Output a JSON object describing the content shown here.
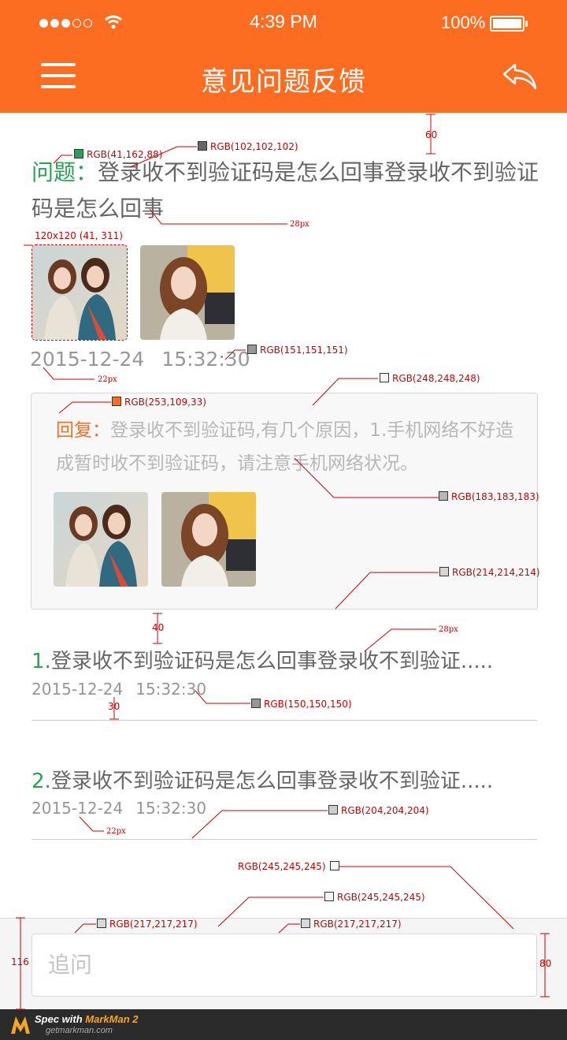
{
  "status": {
    "time": "4:39 PM",
    "battery": "100%"
  },
  "header": {
    "title": "意见问题反馈",
    "menu_icon": "menu-icon",
    "back_icon": "back-arrow-icon",
    "bg_color": "#fd6d21"
  },
  "question": {
    "label": "问题：",
    "text": "登录收不到验证码是怎么回事登录收不到验证码是怎么回事",
    "date": "2015-12-24",
    "time": "15:32:30"
  },
  "reply": {
    "label": "回复：",
    "text": "登录收不到验证码,有几个原因，1.手机网络不好造成暂时收不到验证码，请注意手机网络状况。"
  },
  "items": [
    {
      "index": "1.",
      "title": "登录收不到验证码是怎么回事登录收不到验证.....",
      "date": "2015-12-24",
      "time": "15:32:30"
    },
    {
      "index": "2.",
      "title": "登录收不到验证码是怎么回事登录收不到验证.....",
      "date": "2015-12-24",
      "time": "15:32:30"
    }
  ],
  "input": {
    "placeholder": "追问"
  },
  "footer": {
    "brand_prefix": "Spec with ",
    "brand_name": "MarkMan 2",
    "url": "getmarkman.com"
  },
  "annotations": {
    "a_60": "60",
    "a_green": "RGB(41,162,88)",
    "a_gray102": "RGB(102,102,102)",
    "a_28px_1": "28px",
    "a_img": "120x120 (41, 311)",
    "a_151": "RGB(151,151,151)",
    "a_22px_1": "22px",
    "a_248": "RGB(248,248,248)",
    "a_orange": "RGB(253,109,33)",
    "a_183": "RGB(183,183,183)",
    "a_214": "RGB(214,214,214)",
    "a_40": "40",
    "a_28px_2": "28px",
    "a_150": "RGB(150,150,150)",
    "a_30": "30",
    "a_204": "RGB(204,204,204)",
    "a_22px_2": "22px",
    "a_245a": "RGB(245,245,245)",
    "a_245b": "RGB(245,245,245)",
    "a_217a": "RGB(217,217,217)",
    "a_217b": "RGB(217,217,217)",
    "a_116": "116",
    "a_80": "80"
  }
}
